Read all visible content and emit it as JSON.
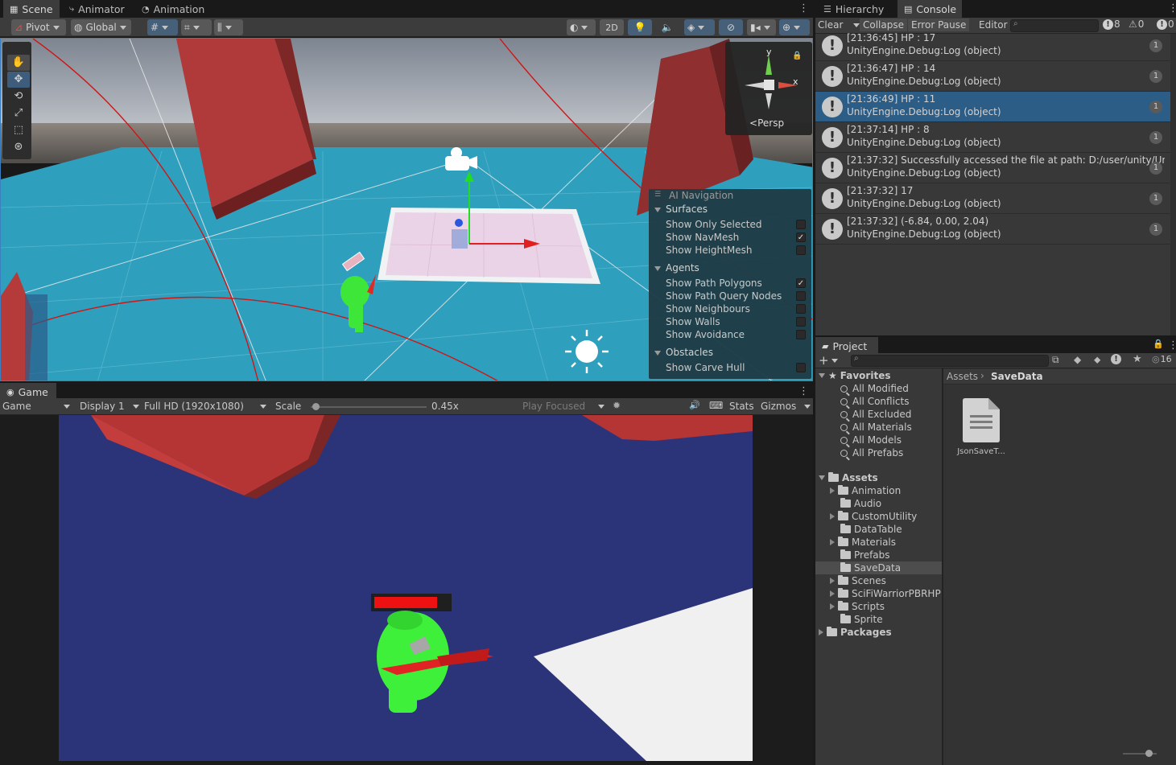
{
  "scene_tabs": [
    {
      "label": "Scene",
      "icon": "grid-icon"
    },
    {
      "label": "Animator",
      "icon": "animator-icon"
    },
    {
      "label": "Animation",
      "icon": "clock-icon"
    }
  ],
  "scene_toolbar": {
    "pivot": "Pivot",
    "global": "Global",
    "mode_2d": "2D"
  },
  "gizmo": {
    "y": "y",
    "x": "x",
    "persp": "Persp"
  },
  "ai_nav": {
    "title": "AI Navigation",
    "sections": [
      {
        "label": "Surfaces",
        "items": [
          {
            "label": "Show Only Selected",
            "checked": false
          },
          {
            "label": "Show NavMesh",
            "checked": true
          },
          {
            "label": "Show HeightMesh",
            "checked": false
          }
        ]
      },
      {
        "label": "Agents",
        "items": [
          {
            "label": "Show Path Polygons",
            "checked": true
          },
          {
            "label": "Show Path Query Nodes",
            "checked": false
          },
          {
            "label": "Show Neighbours",
            "checked": false
          },
          {
            "label": "Show Walls",
            "checked": false
          },
          {
            "label": "Show Avoidance",
            "checked": false
          }
        ]
      },
      {
        "label": "Obstacles",
        "items": [
          {
            "label": "Show Carve Hull",
            "checked": false
          }
        ]
      }
    ]
  },
  "game_tab": {
    "label": "Game"
  },
  "game_toolbar": {
    "view": "Game",
    "display": "Display 1",
    "resolution": "Full HD (1920x1080)",
    "scale_label": "Scale",
    "scale_value": "0.45x",
    "play_focused": "Play Focused",
    "stats": "Stats",
    "gizmos": "Gizmos"
  },
  "right_tabs": {
    "hierarchy": "Hierarchy",
    "console": "Console"
  },
  "console_toolbar": {
    "clear": "Clear",
    "collapse": "Collapse",
    "error_pause": "Error Pause",
    "editor": "Editor",
    "log_count": "8",
    "warn_count": "0",
    "err_count": "0"
  },
  "console_rows": [
    {
      "line1": "[21:36:45] HP : 17",
      "line2": "UnityEngine.Debug:Log (object)",
      "count": "1",
      "selected": false
    },
    {
      "line1": "[21:36:47] HP : 14",
      "line2": "UnityEngine.Debug:Log (object)",
      "count": "1",
      "selected": false
    },
    {
      "line1": "[21:36:49] HP : 11",
      "line2": "UnityEngine.Debug:Log (object)",
      "count": "1",
      "selected": true
    },
    {
      "line1": "[21:37:14] HP : 8",
      "line2": "UnityEngine.Debug:Log (object)",
      "count": "1",
      "selected": false
    },
    {
      "line1": "[21:37:32] Successfully accessed the file at path: D:/user/unity/Unity_TP",
      "line2": "UnityEngine.Debug:Log (object)",
      "count": "1",
      "selected": false
    },
    {
      "line1": "[21:37:32] 17",
      "line2": "UnityEngine.Debug:Log (object)",
      "count": "1",
      "selected": false
    },
    {
      "line1": "[21:37:32] (-6.84, 0.00, 2.04)",
      "line2": "UnityEngine.Debug:Log (object)",
      "count": "1",
      "selected": false
    }
  ],
  "project": {
    "tab": "Project",
    "hidden_count": "16",
    "favorites_label": "Favorites",
    "favorites": [
      "All Modified",
      "All Conflicts",
      "All Excluded",
      "All Materials",
      "All Models",
      "All Prefabs"
    ],
    "assets_label": "Assets",
    "folders": [
      {
        "label": "Animation",
        "expandable": true
      },
      {
        "label": "Audio",
        "expandable": false
      },
      {
        "label": "CustomUtility",
        "expandable": true
      },
      {
        "label": "DataTable",
        "expandable": false
      },
      {
        "label": "Materials",
        "expandable": true
      },
      {
        "label": "Prefabs",
        "expandable": false
      },
      {
        "label": "SaveData",
        "expandable": false,
        "selected": true
      },
      {
        "label": "Scenes",
        "expandable": true
      },
      {
        "label": "SciFiWarriorPBRHP",
        "expandable": true
      },
      {
        "label": "Scripts",
        "expandable": true
      },
      {
        "label": "Sprite",
        "expandable": false
      }
    ],
    "packages_label": "Packages",
    "breadcrumb": [
      "Assets",
      "SaveData"
    ],
    "files": [
      {
        "label": "JsonSaveT...",
        "icon": "document-icon"
      }
    ]
  }
}
